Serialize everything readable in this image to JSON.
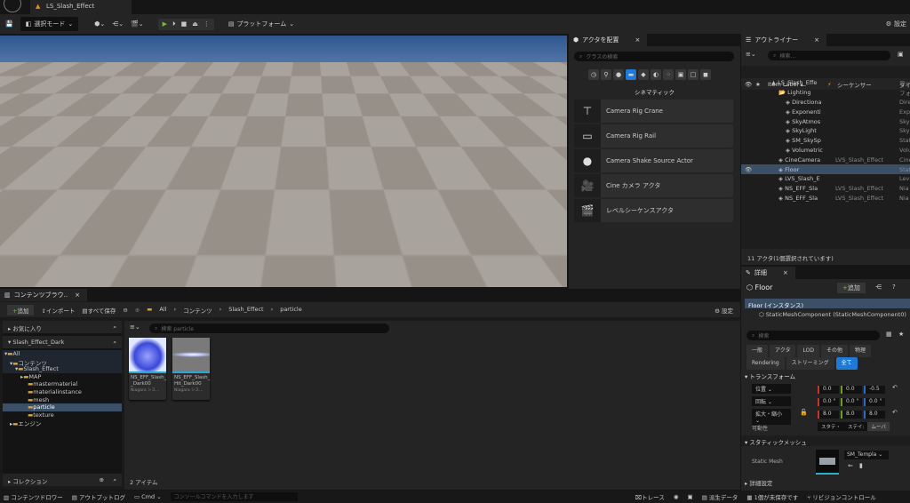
{
  "title_bar": {
    "document_tab": "LS_Slash_Effect"
  },
  "toolbar": {
    "mode": "選択モード",
    "platform": "プラットフォーム",
    "settings": "設定"
  },
  "place_actors": {
    "tab": "アクタを配置",
    "search_placeholder": "クラスの検索",
    "category": "シネマティック",
    "items": [
      {
        "label": "Camera Rig Crane",
        "icon": "crane-icon"
      },
      {
        "label": "Camera Rig Rail",
        "icon": "rail-icon"
      },
      {
        "label": "Camera Shake Source Actor",
        "icon": "sphere-icon"
      },
      {
        "label": "Cine カメラ アクタ",
        "icon": "movie-camera-icon"
      },
      {
        "label": "レベルシーケンスアクタ",
        "icon": "clapperboard-icon"
      }
    ]
  },
  "outliner": {
    "tab": "アウトライナー",
    "search_placeholder": "検索...",
    "col_label": "Item Label ▴",
    "col_sequencer": "シーケンサー",
    "col_type": "タイ",
    "rows": [
      {
        "name": "LS_Slash_Effe",
        "seq": "",
        "type": "ワー"
      },
      {
        "name": "Lighting",
        "seq": "",
        "type": "フォ"
      },
      {
        "name": "Directiona",
        "seq": "",
        "type": "Dire"
      },
      {
        "name": "Exponenti",
        "seq": "",
        "type": "Exp"
      },
      {
        "name": "SkyAtmos",
        "seq": "",
        "type": "Sky"
      },
      {
        "name": "SkyLight",
        "seq": "",
        "type": "Sky"
      },
      {
        "name": "SM_SkySp",
        "seq": "",
        "type": "Stat"
      },
      {
        "name": "Volumetric",
        "seq": "",
        "type": "Volu"
      },
      {
        "name": "CineCamera",
        "seq": "LVS_Slash_Effect",
        "type": "Cine"
      },
      {
        "name": "Floor",
        "seq": "",
        "type": "Stat"
      },
      {
        "name": "LVS_Slash_E",
        "seq": "",
        "type": "Lev"
      },
      {
        "name": "NS_EFF_Sla",
        "seq": "LVS_Slash_Effect",
        "type": "Nia"
      },
      {
        "name": "NS_EFF_Sla",
        "seq": "LVS_Slash_Effect",
        "type": "Nia"
      }
    ],
    "status": "11 アクタ(1個選択されています)"
  },
  "details": {
    "tab": "詳細",
    "actor": "Floor",
    "add": "追加",
    "instance": "Floor (インスタンス)",
    "component": "StaticMeshComponent (StaticMeshComponent0)",
    "search_placeholder": "検索",
    "filters": [
      "一般",
      "アクタ",
      "LOD",
      "その他",
      "物理",
      "Rendering",
      "ストリーミング",
      "全て"
    ],
    "transform_section": "トランスフォーム",
    "location": {
      "label": "位置",
      "x": "0.0",
      "y": "0.0",
      "z": "-0.5"
    },
    "rotation": {
      "label": "回転",
      "x": "0.0 °",
      "y": "0.0 °",
      "z": "0.0 °"
    },
    "scale": {
      "label": "拡大・縮小",
      "x": "8.0",
      "y": "8.0",
      "z": "8.0"
    },
    "mobility": {
      "label": "可動性",
      "options": [
        "スタテ・",
        "ステイ:",
        "ムーバ"
      ]
    },
    "static_mesh_section": "スタティックメッシュ",
    "static_mesh_label": "Static Mesh",
    "static_mesh_value": "SM_Templa",
    "advanced": "詳細設定"
  },
  "content_browser": {
    "tab": "コンテンツブラウ..",
    "add": "追加",
    "import": "インポート",
    "save_all": "すべて保存",
    "breadcrumb": [
      "All",
      "コンテンツ",
      "Slash_Effect",
      "particle"
    ],
    "settings": "設定",
    "favorites": "お気に入り",
    "project": "Slash_Effect_Dark",
    "tree": [
      "All",
      "コンテンツ",
      "Slash_Effect",
      "MAP",
      "mastermaterial",
      "materialinstance",
      "mesh",
      "particle",
      "texture",
      "エンジン"
    ],
    "collections": "コレクション",
    "search_placeholder": "検索 particle",
    "assets": [
      {
        "name": "NS_EFF_Slash_ _Dark00",
        "type": "Niagara シス..."
      },
      {
        "name": "NS_EFF_Slash_ Hit_Dark00",
        "type": "Niagara シス..."
      }
    ],
    "count": "2 アイテム"
  },
  "status_bar": {
    "drawer": "コンテンツドロワー",
    "output_log": "アウトプットログ",
    "cmd": "Cmd",
    "console_placeholder": "コンソールコマンドを入力します",
    "trace": "トレース",
    "derived": "派生データ",
    "unsaved": "1個が未保存です",
    "revision": "リビジョンコントロール"
  }
}
